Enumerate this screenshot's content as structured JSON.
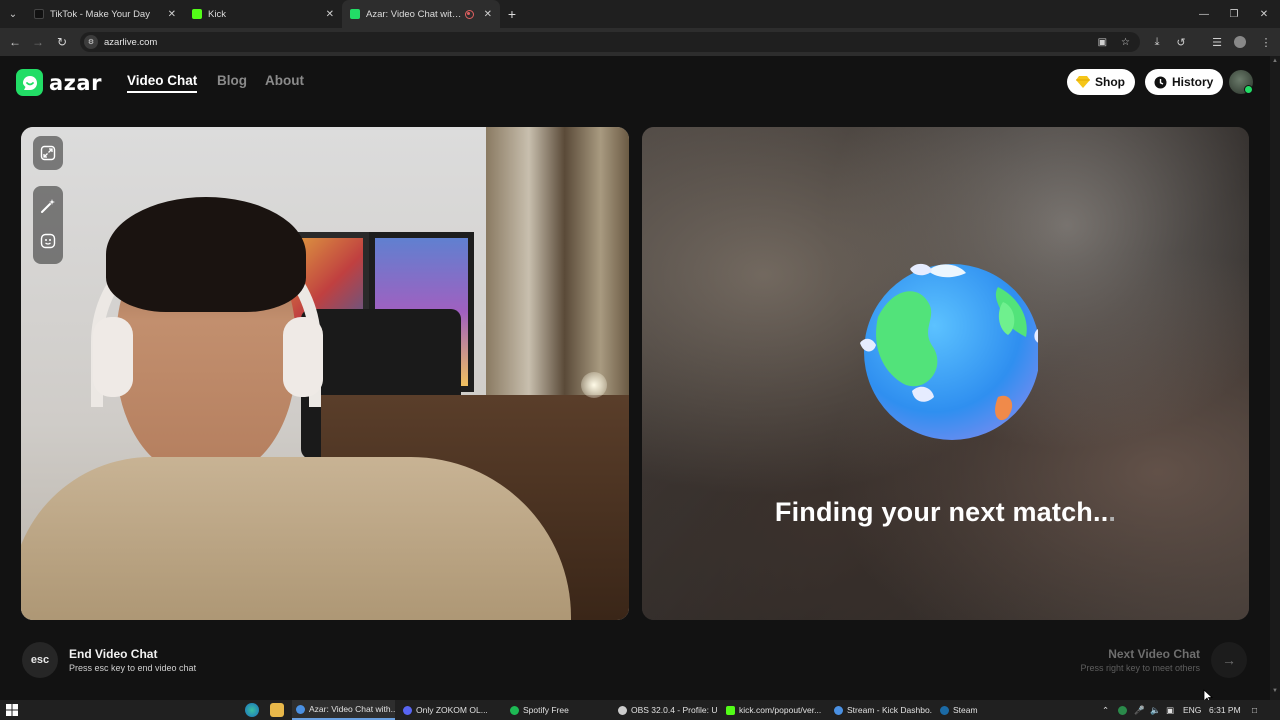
{
  "browser": {
    "tabs": [
      {
        "title": "TikTok - Make Your Day",
        "favicon_color": "#111111",
        "active": false
      },
      {
        "title": "Kick",
        "favicon_color": "#53fc18",
        "active": false
      },
      {
        "title": "Azar: Video Chat with New",
        "favicon_color": "#22dd66",
        "active": true
      }
    ],
    "new_tab_icon": "plus-icon",
    "url": "azarlive.com"
  },
  "site": {
    "logo_text": "azar",
    "nav": [
      {
        "label": "Video Chat",
        "active": true
      },
      {
        "label": "Blog",
        "active": false
      },
      {
        "label": "About",
        "active": false
      }
    ],
    "shop_label": "Shop",
    "history_label": "History",
    "accent_color": "#22dd66"
  },
  "match_panel": {
    "status_text": "Finding your next match",
    "status_ellipsis_bright": "..",
    "status_ellipsis_dim": "."
  },
  "controls": {
    "esc_key": "esc",
    "end_title": "End Video Chat",
    "end_subtitle": "Press esc key to end video chat",
    "next_title": "Next Video Chat",
    "next_subtitle": "Press right key to meet others"
  },
  "taskbar": {
    "apps": [
      {
        "label": "Azar: Video Chat with...",
        "color": "#4a90e2",
        "active": true
      },
      {
        "label": "Only ZOKOM OL...",
        "color": "#5865f2",
        "active": false
      },
      {
        "label": "Spotify Free",
        "color": "#1db954",
        "active": false
      },
      {
        "label": "OBS 32.0.4 - Profile: U...",
        "color": "#cccccc",
        "active": false
      },
      {
        "label": "kick.com/popout/ver...",
        "color": "#53fc18",
        "active": false
      },
      {
        "label": "Stream - Kick Dashbo...",
        "color": "#4a90e2",
        "active": false
      },
      {
        "label": "Steam",
        "color": "#1b6aa5",
        "active": false
      }
    ],
    "language": "ENG",
    "time": "6:31 PM"
  }
}
